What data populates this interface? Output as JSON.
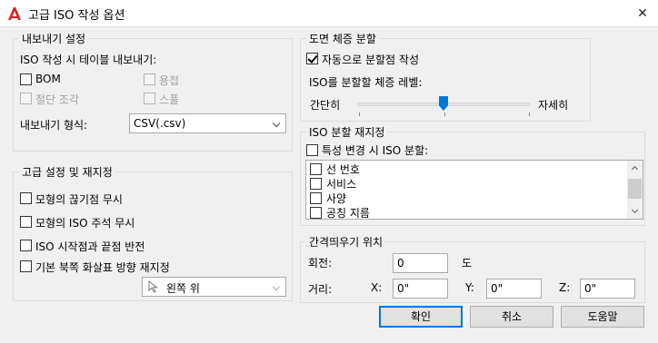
{
  "window": {
    "title": "고급 ISO 작성 옵션",
    "close_glyph": "✕",
    "icon": "autocad-a-icon",
    "accent": "#e01c1c"
  },
  "export": {
    "group_title": "내보내기 설정",
    "caption": "ISO 작성 시 테이블 내보내기:",
    "bom": "BOM",
    "weld": "용접",
    "cut_piece": "절단 조각",
    "spool": "스풀",
    "format_label": "내보내기 형식:",
    "format_value": "CSV(.csv)"
  },
  "advanced": {
    "group_title": "고급 설정 및 재지정",
    "ignore_model_breaks": "모형의 끊기점 무시",
    "ignore_iso_annotations": "모형의 ISO 주석 무시",
    "reverse_start_end": "ISO 시작점과 끝점 반전",
    "override_north_arrow": "기본 북쪽 화살표 방향 재지정",
    "north_arrow_value": "왼쪽 위"
  },
  "split": {
    "group_title": "도면 체증 분할",
    "auto_split": "자동으로 분할점 작성",
    "auto_split_checked": true,
    "level_label": "ISO를 분할할 체증 레벨:",
    "min_label": "간단히",
    "max_label": "자세히",
    "slider_level": 0.5
  },
  "iso_split_override": {
    "group_title": "ISO 분할 재지정",
    "on_property_change": "특성 변경 시 ISO 분할:",
    "items": [
      {
        "label": "선 번호"
      },
      {
        "label": "서비스"
      },
      {
        "label": "사양"
      },
      {
        "label": "공칭 지름"
      }
    ]
  },
  "spacing": {
    "group_title": "간격띄우기 위치",
    "rotation_label": "회전:",
    "rotation_value": "0",
    "rotation_unit": "도",
    "distance_label": "거리:",
    "x_label": "X:",
    "x_value": "0\"",
    "y_label": "Y:",
    "y_value": "0\"",
    "z_label": "Z:",
    "z_value": "0\""
  },
  "buttons": {
    "ok": "확인",
    "cancel": "취소",
    "help": "도움말"
  }
}
